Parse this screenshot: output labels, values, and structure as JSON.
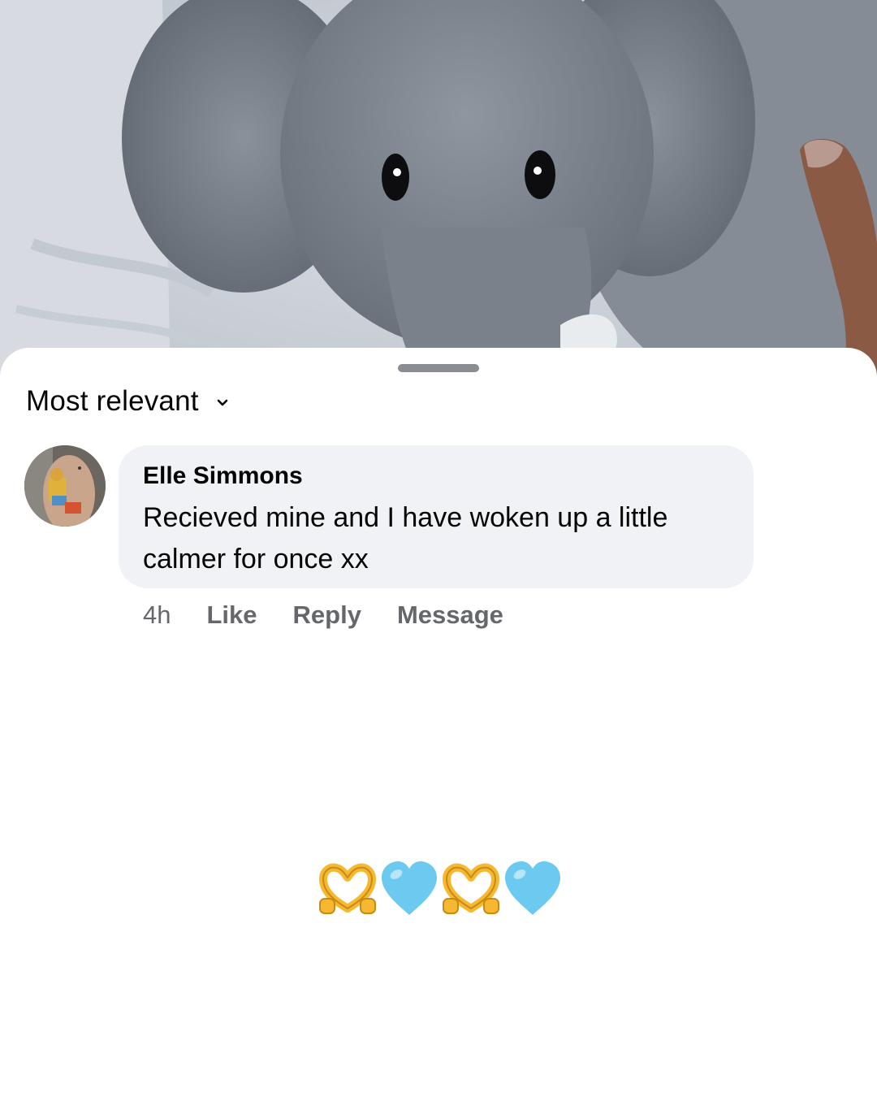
{
  "photo": {
    "subject": "grey plush elephant toy",
    "colors": {
      "fur": "#7d8590",
      "background": "#c9d0d8"
    }
  },
  "sheet": {
    "sort_label": "Most relevant",
    "sort_icon": "chevron-down-icon"
  },
  "comment": {
    "author": "Elle Simmons",
    "text": "Recieved mine and I have woken up a little calmer for once xx",
    "time": "4h",
    "actions": {
      "like": "Like",
      "reply": "Reply",
      "message": "Message"
    }
  },
  "emojis": [
    {
      "name": "heart-hands-emoji",
      "glyph": "🫶"
    },
    {
      "name": "light-blue-heart-emoji",
      "glyph": "🩵"
    },
    {
      "name": "heart-hands-emoji",
      "glyph": "🫶"
    },
    {
      "name": "light-blue-heart-emoji",
      "glyph": "🩵"
    }
  ],
  "colors": {
    "text": "#050505",
    "secondary": "#65676b",
    "bubble": "#f0f2f5",
    "heart_blue": "#6cc9ef",
    "hand_yellow": "#f6b830"
  }
}
